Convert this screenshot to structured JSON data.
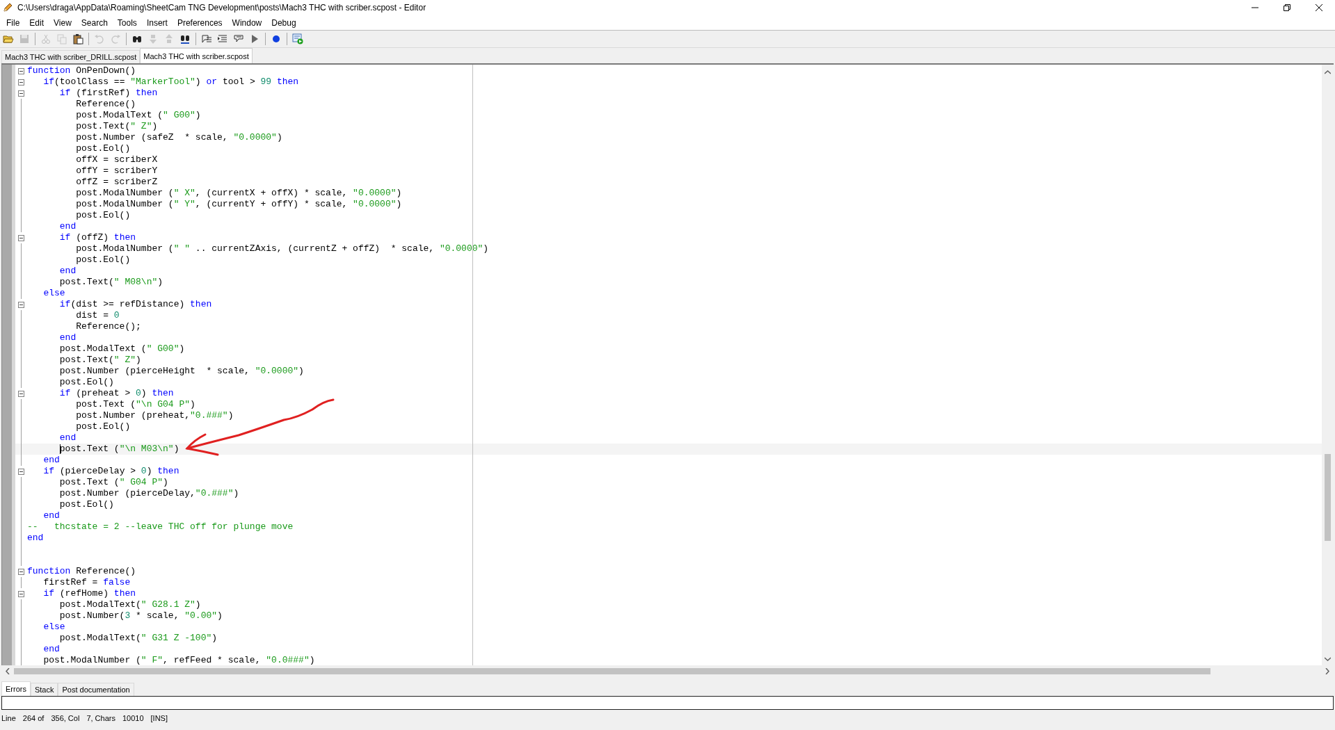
{
  "window": {
    "title": "C:\\Users\\draga\\AppData\\Roaming\\SheetCam TNG Development\\posts\\Mach3 THC with scriber.scpost - Editor"
  },
  "menu": [
    "File",
    "Edit",
    "View",
    "Search",
    "Tools",
    "Insert",
    "Preferences",
    "Window",
    "Debug"
  ],
  "toolbar": [
    {
      "kind": "open",
      "disabled": false
    },
    {
      "kind": "save",
      "disabled": true
    },
    {
      "kind": "sep"
    },
    {
      "kind": "cut",
      "disabled": true
    },
    {
      "kind": "copy",
      "disabled": true
    },
    {
      "kind": "paste",
      "disabled": false
    },
    {
      "kind": "sep"
    },
    {
      "kind": "undo",
      "disabled": true
    },
    {
      "kind": "redo",
      "disabled": true
    },
    {
      "kind": "sep"
    },
    {
      "kind": "find",
      "disabled": false
    },
    {
      "kind": "down",
      "disabled": true
    },
    {
      "kind": "up",
      "disabled": true
    },
    {
      "kind": "replace",
      "disabled": false
    },
    {
      "kind": "sep"
    },
    {
      "kind": "list",
      "disabled": false
    },
    {
      "kind": "list2",
      "disabled": false
    },
    {
      "kind": "list3",
      "disabled": false
    },
    {
      "kind": "play",
      "disabled": false
    },
    {
      "kind": "sep"
    },
    {
      "kind": "dot",
      "disabled": false
    },
    {
      "kind": "sep"
    },
    {
      "kind": "run",
      "disabled": false
    }
  ],
  "tabs": [
    {
      "label": "Mach3 THC with scriber_DRILL.scpost",
      "selected": false
    },
    {
      "label": "Mach3 THC with scriber.scpost",
      "selected": true
    }
  ],
  "editor": {
    "lines": [
      {
        "fold": true,
        "current": false,
        "tokens": [
          {
            "kind": "k",
            "text": "function"
          },
          {
            "kind": "p",
            "text": " OnPenDown()"
          }
        ]
      },
      {
        "fold": true,
        "current": false,
        "tokens": [
          {
            "kind": "k",
            "text": "   if"
          },
          {
            "kind": "p",
            "text": "(toolClass == "
          },
          {
            "kind": "s",
            "text": "\"MarkerTool\""
          },
          {
            "kind": "p",
            "text": ") "
          },
          {
            "kind": "k",
            "text": "or"
          },
          {
            "kind": "p",
            "text": " tool > "
          },
          {
            "kind": "n",
            "text": "99"
          },
          {
            "kind": "k",
            "text": " then"
          }
        ]
      },
      {
        "fold": true,
        "current": false,
        "tokens": [
          {
            "kind": "k",
            "text": "      if"
          },
          {
            "kind": "p",
            "text": " (firstRef) "
          },
          {
            "kind": "k",
            "text": "then"
          }
        ]
      },
      {
        "fold": false,
        "current": false,
        "tokens": [
          {
            "kind": "p",
            "text": "         Reference()"
          }
        ]
      },
      {
        "fold": false,
        "current": false,
        "tokens": [
          {
            "kind": "p",
            "text": "         post.ModalText ("
          },
          {
            "kind": "s",
            "text": "\" G00\""
          },
          {
            "kind": "p",
            "text": ")"
          }
        ]
      },
      {
        "fold": false,
        "current": false,
        "tokens": [
          {
            "kind": "p",
            "text": "         post.Text("
          },
          {
            "kind": "s",
            "text": "\" Z\""
          },
          {
            "kind": "p",
            "text": ")"
          }
        ]
      },
      {
        "fold": false,
        "current": false,
        "tokens": [
          {
            "kind": "p",
            "text": "         post.Number (safeZ  * scale, "
          },
          {
            "kind": "s",
            "text": "\"0.0000\""
          },
          {
            "kind": "p",
            "text": ")"
          }
        ]
      },
      {
        "fold": false,
        "current": false,
        "tokens": [
          {
            "kind": "p",
            "text": "         post.Eol()"
          }
        ]
      },
      {
        "fold": false,
        "current": false,
        "tokens": [
          {
            "kind": "p",
            "text": "         offX = scriberX"
          }
        ]
      },
      {
        "fold": false,
        "current": false,
        "tokens": [
          {
            "kind": "p",
            "text": "         offY = scriberY"
          }
        ]
      },
      {
        "fold": false,
        "current": false,
        "tokens": [
          {
            "kind": "p",
            "text": "         offZ = scriberZ"
          }
        ]
      },
      {
        "fold": false,
        "current": false,
        "tokens": [
          {
            "kind": "p",
            "text": "         post.ModalNumber ("
          },
          {
            "kind": "s",
            "text": "\" X\""
          },
          {
            "kind": "p",
            "text": ", (currentX + offX) * scale, "
          },
          {
            "kind": "s",
            "text": "\"0.0000\""
          },
          {
            "kind": "p",
            "text": ")"
          }
        ]
      },
      {
        "fold": false,
        "current": false,
        "tokens": [
          {
            "kind": "p",
            "text": "         post.ModalNumber ("
          },
          {
            "kind": "s",
            "text": "\" Y\""
          },
          {
            "kind": "p",
            "text": ", (currentY + offY) * scale, "
          },
          {
            "kind": "s",
            "text": "\"0.0000\""
          },
          {
            "kind": "p",
            "text": ")"
          }
        ]
      },
      {
        "fold": false,
        "current": false,
        "tokens": [
          {
            "kind": "p",
            "text": "         post.Eol()"
          }
        ]
      },
      {
        "fold": false,
        "current": false,
        "tokens": [
          {
            "kind": "k",
            "text": "      end"
          }
        ]
      },
      {
        "fold": true,
        "current": false,
        "tokens": [
          {
            "kind": "k",
            "text": "      if"
          },
          {
            "kind": "p",
            "text": " (offZ) "
          },
          {
            "kind": "k",
            "text": "then"
          }
        ]
      },
      {
        "fold": false,
        "current": false,
        "tokens": [
          {
            "kind": "p",
            "text": "         post.ModalNumber ("
          },
          {
            "kind": "s",
            "text": "\" \""
          },
          {
            "kind": "p",
            "text": " .. currentZAxis, (currentZ + offZ)  * scale, "
          },
          {
            "kind": "s",
            "text": "\"0.0000\""
          },
          {
            "kind": "p",
            "text": ")"
          }
        ]
      },
      {
        "fold": false,
        "current": false,
        "tokens": [
          {
            "kind": "p",
            "text": "         post.Eol()"
          }
        ]
      },
      {
        "fold": false,
        "current": false,
        "tokens": [
          {
            "kind": "k",
            "text": "      end"
          }
        ]
      },
      {
        "fold": false,
        "current": false,
        "tokens": [
          {
            "kind": "p",
            "text": "      post.Text("
          },
          {
            "kind": "s",
            "text": "\" M08\\n\""
          },
          {
            "kind": "p",
            "text": ")"
          }
        ]
      },
      {
        "fold": false,
        "current": false,
        "tokens": [
          {
            "kind": "k",
            "text": "   else"
          }
        ]
      },
      {
        "fold": true,
        "current": false,
        "tokens": [
          {
            "kind": "k",
            "text": "      if"
          },
          {
            "kind": "p",
            "text": "(dist >= refDistance) "
          },
          {
            "kind": "k",
            "text": "then"
          }
        ]
      },
      {
        "fold": false,
        "current": false,
        "tokens": [
          {
            "kind": "p",
            "text": "         dist = "
          },
          {
            "kind": "n",
            "text": "0"
          }
        ]
      },
      {
        "fold": false,
        "current": false,
        "tokens": [
          {
            "kind": "p",
            "text": "         Reference();"
          }
        ]
      },
      {
        "fold": false,
        "current": false,
        "tokens": [
          {
            "kind": "k",
            "text": "      end"
          }
        ]
      },
      {
        "fold": false,
        "current": false,
        "tokens": [
          {
            "kind": "p",
            "text": "      post.ModalText ("
          },
          {
            "kind": "s",
            "text": "\" G00\""
          },
          {
            "kind": "p",
            "text": ")"
          }
        ]
      },
      {
        "fold": false,
        "current": false,
        "tokens": [
          {
            "kind": "p",
            "text": "      post.Text("
          },
          {
            "kind": "s",
            "text": "\" Z\""
          },
          {
            "kind": "p",
            "text": ")"
          }
        ]
      },
      {
        "fold": false,
        "current": false,
        "tokens": [
          {
            "kind": "p",
            "text": "      post.Number (pierceHeight  * scale, "
          },
          {
            "kind": "s",
            "text": "\"0.0000\""
          },
          {
            "kind": "p",
            "text": ")"
          }
        ]
      },
      {
        "fold": false,
        "current": false,
        "tokens": [
          {
            "kind": "p",
            "text": "      post.Eol()"
          }
        ]
      },
      {
        "fold": true,
        "current": false,
        "tokens": [
          {
            "kind": "k",
            "text": "      if"
          },
          {
            "kind": "p",
            "text": " (preheat > "
          },
          {
            "kind": "n",
            "text": "0"
          },
          {
            "kind": "p",
            "text": ") "
          },
          {
            "kind": "k",
            "text": "then"
          }
        ]
      },
      {
        "fold": false,
        "current": false,
        "tokens": [
          {
            "kind": "p",
            "text": "         post.Text ("
          },
          {
            "kind": "s",
            "text": "\"\\n G04 P\""
          },
          {
            "kind": "p",
            "text": ")"
          }
        ]
      },
      {
        "fold": false,
        "current": false,
        "tokens": [
          {
            "kind": "p",
            "text": "         post.Number (preheat,"
          },
          {
            "kind": "s",
            "text": "\"0.###\""
          },
          {
            "kind": "p",
            "text": ")"
          }
        ]
      },
      {
        "fold": false,
        "current": false,
        "tokens": [
          {
            "kind": "p",
            "text": "         post.Eol()"
          }
        ]
      },
      {
        "fold": false,
        "current": false,
        "tokens": [
          {
            "kind": "k",
            "text": "      end"
          }
        ]
      },
      {
        "fold": false,
        "current": true,
        "tokens": [
          {
            "kind": "p",
            "text": "      post.Text ("
          },
          {
            "kind": "s",
            "text": "\"\\n M03\\n\""
          },
          {
            "kind": "p",
            "text": ")"
          }
        ]
      },
      {
        "fold": false,
        "current": false,
        "tokens": [
          {
            "kind": "k",
            "text": "   end"
          }
        ]
      },
      {
        "fold": true,
        "current": false,
        "tokens": [
          {
            "kind": "k",
            "text": "   if"
          },
          {
            "kind": "p",
            "text": " (pierceDelay > "
          },
          {
            "kind": "n",
            "text": "0"
          },
          {
            "kind": "p",
            "text": ") "
          },
          {
            "kind": "k",
            "text": "then"
          }
        ]
      },
      {
        "fold": false,
        "current": false,
        "tokens": [
          {
            "kind": "p",
            "text": "      post.Text ("
          },
          {
            "kind": "s",
            "text": "\" G04 P\""
          },
          {
            "kind": "p",
            "text": ")"
          }
        ]
      },
      {
        "fold": false,
        "current": false,
        "tokens": [
          {
            "kind": "p",
            "text": "      post.Number (pierceDelay,"
          },
          {
            "kind": "s",
            "text": "\"0.###\""
          },
          {
            "kind": "p",
            "text": ")"
          }
        ]
      },
      {
        "fold": false,
        "current": false,
        "tokens": [
          {
            "kind": "p",
            "text": "      post.Eol()"
          }
        ]
      },
      {
        "fold": false,
        "current": false,
        "tokens": [
          {
            "kind": "k",
            "text": "   end"
          }
        ]
      },
      {
        "fold": false,
        "current": false,
        "tokens": [
          {
            "kind": "c",
            "text": "--   thcstate = 2 --leave THC off for plunge move"
          }
        ]
      },
      {
        "fold": false,
        "current": false,
        "tokens": [
          {
            "kind": "k",
            "text": "end"
          }
        ]
      },
      {
        "fold": false,
        "current": false
      },
      {
        "fold": false,
        "current": false
      },
      {
        "fold": true,
        "current": false,
        "tokens": [
          {
            "kind": "k",
            "text": "function"
          },
          {
            "kind": "p",
            "text": " Reference()"
          }
        ]
      },
      {
        "fold": false,
        "current": false,
        "tokens": [
          {
            "kind": "p",
            "text": "   firstRef = "
          },
          {
            "kind": "k",
            "text": "false"
          }
        ]
      },
      {
        "fold": true,
        "current": false,
        "tokens": [
          {
            "kind": "k",
            "text": "   if"
          },
          {
            "kind": "p",
            "text": " (refHome) "
          },
          {
            "kind": "k",
            "text": "then"
          }
        ]
      },
      {
        "fold": false,
        "current": false,
        "tokens": [
          {
            "kind": "p",
            "text": "      post.ModalText("
          },
          {
            "kind": "s",
            "text": "\" G28.1 Z\""
          },
          {
            "kind": "p",
            "text": ")"
          }
        ]
      },
      {
        "fold": false,
        "current": false,
        "tokens": [
          {
            "kind": "p",
            "text": "      post.Number("
          },
          {
            "kind": "n",
            "text": "3"
          },
          {
            "kind": "p",
            "text": " * scale, "
          },
          {
            "kind": "s",
            "text": "\"0.00\""
          },
          {
            "kind": "p",
            "text": ")"
          }
        ]
      },
      {
        "fold": false,
        "current": false,
        "tokens": [
          {
            "kind": "k",
            "text": "   else"
          }
        ]
      },
      {
        "fold": false,
        "current": false,
        "tokens": [
          {
            "kind": "p",
            "text": "      post.ModalText("
          },
          {
            "kind": "s",
            "text": "\" G31 Z -100\""
          },
          {
            "kind": "p",
            "text": ")"
          }
        ]
      },
      {
        "fold": false,
        "current": false,
        "tokens": [
          {
            "kind": "k",
            "text": "   end"
          }
        ]
      },
      {
        "fold": false,
        "current": false,
        "tokens": [
          {
            "kind": "p",
            "text": "   post.ModalNumber ("
          },
          {
            "kind": "s",
            "text": "\" F\""
          },
          {
            "kind": "p",
            "text": ", refFeed * scale, "
          },
          {
            "kind": "s",
            "text": "\"0.0###\""
          },
          {
            "kind": "p",
            "text": ")"
          }
        ]
      }
    ]
  },
  "bottom_tabs": [
    {
      "label": "Errors",
      "selected": true
    },
    {
      "label": "Stack",
      "selected": false
    },
    {
      "label": "Post documentation",
      "selected": false
    }
  ],
  "status_bar": [
    "Line",
    "264 of",
    "356, Col",
    "7, Chars",
    "10010",
    "[INS]"
  ]
}
